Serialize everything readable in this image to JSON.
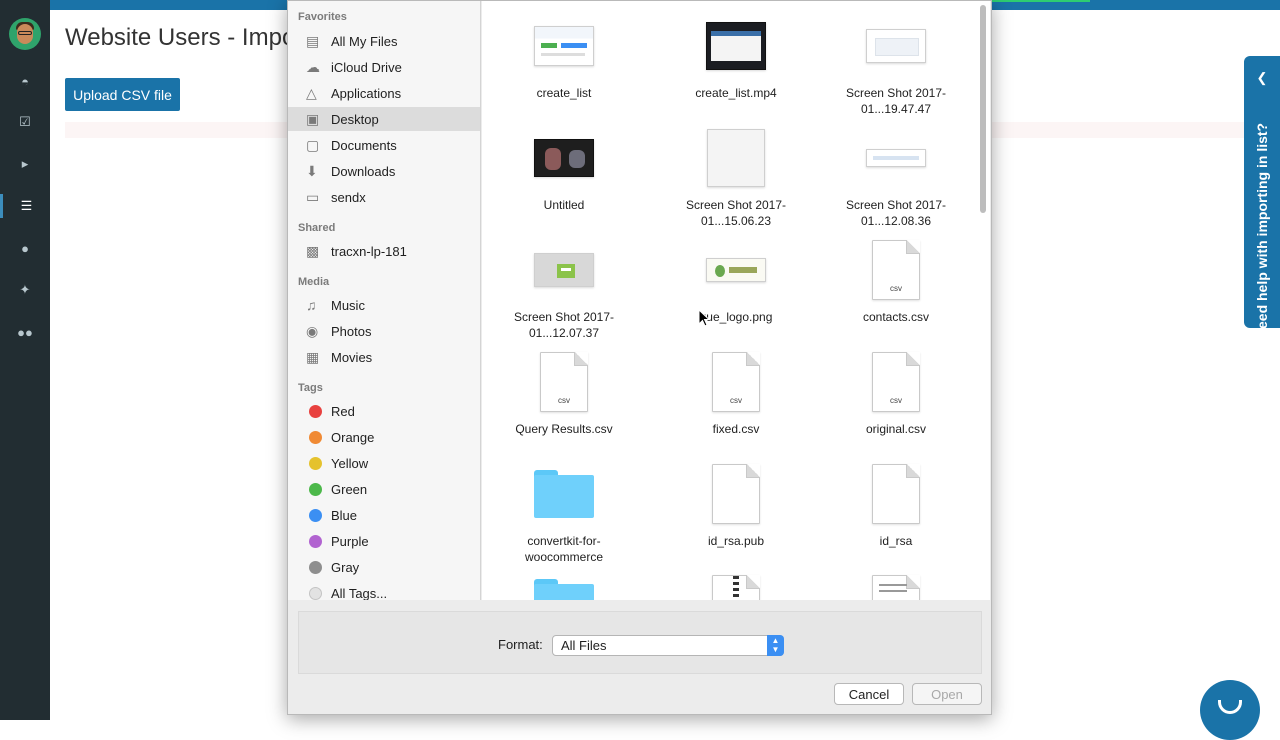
{
  "app": {
    "page_title": "Website Users - Import",
    "upload_button": "Upload CSV file",
    "help_tab": "Need help with importing in list?",
    "colors": {
      "brand": "#1a73a8",
      "sidebar": "#222d32"
    },
    "nav_icons": [
      "dashboard-icon",
      "check-square-icon",
      "megaphone-icon",
      "list-icon",
      "drop-icon",
      "magic-wand-icon",
      "users-icon"
    ]
  },
  "dialog": {
    "sidebar": {
      "favorites_title": "Favorites",
      "favorites": [
        {
          "label": "All My Files",
          "icon": "all-files-icon"
        },
        {
          "label": "iCloud Drive",
          "icon": "cloud-icon"
        },
        {
          "label": "Applications",
          "icon": "applications-icon"
        },
        {
          "label": "Desktop",
          "icon": "desktop-icon",
          "selected": true
        },
        {
          "label": "Documents",
          "icon": "documents-icon"
        },
        {
          "label": "Downloads",
          "icon": "downloads-icon"
        },
        {
          "label": "sendx",
          "icon": "folder-icon"
        }
      ],
      "shared_title": "Shared",
      "shared": [
        {
          "label": "tracxn-lp-181",
          "icon": "computer-icon"
        }
      ],
      "media_title": "Media",
      "media": [
        {
          "label": "Music",
          "icon": "music-icon"
        },
        {
          "label": "Photos",
          "icon": "camera-icon"
        },
        {
          "label": "Movies",
          "icon": "film-icon"
        }
      ],
      "tags_title": "Tags",
      "tags": [
        {
          "label": "Red",
          "color": "#e8413f"
        },
        {
          "label": "Orange",
          "color": "#f08a34"
        },
        {
          "label": "Yellow",
          "color": "#e5c22d"
        },
        {
          "label": "Green",
          "color": "#4cb84a"
        },
        {
          "label": "Blue",
          "color": "#3b8ff3"
        },
        {
          "label": "Purple",
          "color": "#b163d0"
        },
        {
          "label": "Gray",
          "color": "#8e8e8e"
        },
        {
          "label": "All Tags...",
          "color": "#e2e2e2"
        }
      ]
    },
    "files": [
      {
        "name": "create_list",
        "kind": "screenshot"
      },
      {
        "name": "create_list.mp4",
        "kind": "video"
      },
      {
        "name": "Screen Shot 2017-01...19.47.47",
        "kind": "screenshot-light"
      },
      {
        "name": "Untitled",
        "kind": "photo-dark"
      },
      {
        "name": "Screen Shot 2017-01...15.06.23",
        "kind": "blank-image"
      },
      {
        "name": "Screen Shot 2017-01...12.08.36",
        "kind": "screenshot-thin"
      },
      {
        "name": "Screen Shot 2017-01...12.07.37",
        "kind": "screenshot-green"
      },
      {
        "name": "que_logo.png",
        "kind": "logo"
      },
      {
        "name": "contacts.csv",
        "kind": "csv"
      },
      {
        "name": "Query Results.csv",
        "kind": "csv"
      },
      {
        "name": "fixed.csv",
        "kind": "csv"
      },
      {
        "name": "original.csv",
        "kind": "csv"
      },
      {
        "name": "convertkit-for-woocommerce",
        "kind": "folder"
      },
      {
        "name": "id_rsa.pub",
        "kind": "doc"
      },
      {
        "name": "id_rsa",
        "kind": "doc"
      },
      {
        "name": "",
        "kind": "folder"
      },
      {
        "name": "",
        "kind": "zip"
      },
      {
        "name": "",
        "kind": "pdf"
      }
    ],
    "csv_ext": "csv",
    "format_label": "Format:",
    "format_value": "All Files",
    "cancel_button": "Cancel",
    "open_button": "Open"
  }
}
